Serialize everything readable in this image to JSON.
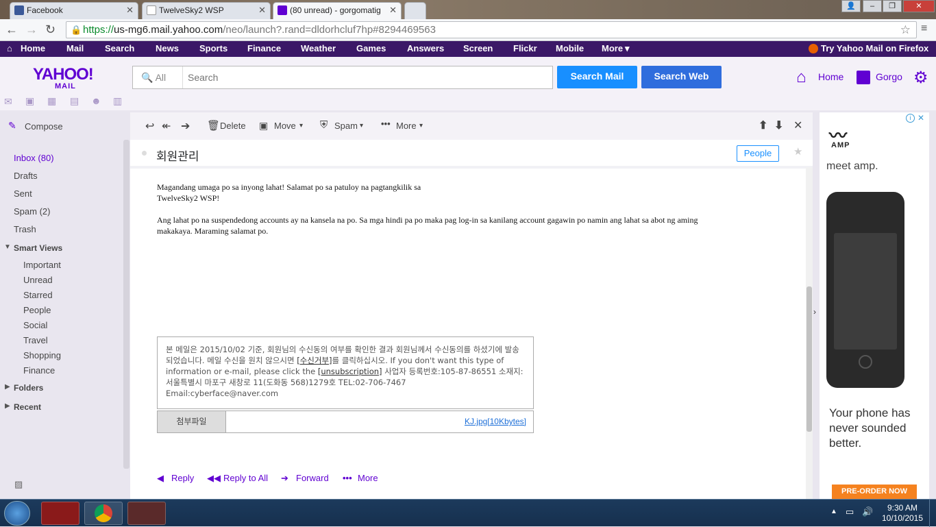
{
  "browser": {
    "tabs": [
      {
        "title": "Facebook",
        "active": false
      },
      {
        "title": "TwelveSky2 WSP",
        "active": false
      },
      {
        "title": "(80 unread) - gorgomatig",
        "active": true
      }
    ],
    "url_scheme": "https://",
    "url_host": "us-mg6.mail.yahoo.com",
    "url_path": "/neo/launch?.rand=dldorhcluf7hp#8294469563"
  },
  "ynav": {
    "items": [
      "Home",
      "Mail",
      "Search",
      "News",
      "Sports",
      "Finance",
      "Weather",
      "Games",
      "Answers",
      "Screen",
      "Flickr",
      "Mobile",
      "More"
    ],
    "firefox": "Try Yahoo Mail on Firefox »"
  },
  "header": {
    "logo": "YAHOO!",
    "logo_sub": "MAIL",
    "search_scope": "All",
    "search_placeholder": "Search",
    "search_mail": "Search Mail",
    "search_web": "Search Web",
    "home": "Home",
    "user": "Gorgo"
  },
  "sidebar": {
    "compose": "Compose",
    "folders": [
      "Inbox (80)",
      "Drafts",
      "Sent",
      "Spam (2)",
      "Trash"
    ],
    "smart_views": "Smart Views",
    "smart_items": [
      "Important",
      "Unread",
      "Starred",
      "People",
      "Social",
      "Travel",
      "Shopping",
      "Finance"
    ],
    "folders_label": "Folders",
    "recent_label": "Recent"
  },
  "toolbar": {
    "delete": "Delete",
    "move": "Move",
    "spam": "Spam",
    "more": "More"
  },
  "message": {
    "subject": "회원관리",
    "people": "People",
    "body_p1_line1": "Magandang umaga po sa inyong lahat! Salamat po sa patuloy na pagtangkilik sa",
    "body_p1_line2": "TwelveSky2 WSP!",
    "body_p2_line1": "Ang lahat po na suspendedong accounts ay na kansela na po. Sa mga hindi pa po maka pag log-in sa kanilang account gagawin po namin ang lahat sa abot ng aming",
    "body_p2_line2": "makakaya. Maraming salamat po.",
    "footer_a": "본 메일은 2015/10/02 기준, 회원님의 수신동의 여부를 확인한 결과 회원님께서 수신동의를 하셨기에 발송되었습니다. 메일 수신을 원치 않으시면 ",
    "footer_link1": "[수신거부]",
    "footer_b": "를 클릭하십시오. If you don't want this type of information or e-mail, please click the ",
    "footer_link2": "[unsubscription]",
    "footer_c": " 사업자 등록번호:105-87-86551 소재지:서울특별시 마포구 새창로 11(도화동 568)1279호 TEL:02-706-7467",
    "footer_email": "Email:cyberface@naver.com",
    "attach_label": "첨부파일",
    "attach_file": "KJ.jpg[10Kbytes]"
  },
  "actions": {
    "reply": "Reply",
    "reply_all": "Reply to All",
    "forward": "Forward",
    "more": "More"
  },
  "ad": {
    "brand": "AMP",
    "tagline": "meet amp.",
    "copy": "Your phone has never sounded better.",
    "cta": "PRE-ORDER NOW"
  },
  "taskbar": {
    "time": "9:30 AM",
    "date": "10/10/2015"
  },
  "colors": {
    "yahoo_purple": "#6001d2",
    "topbar": "#3b1867",
    "search_mail_btn": "#188fff",
    "search_web_btn": "#2f6ddd"
  }
}
